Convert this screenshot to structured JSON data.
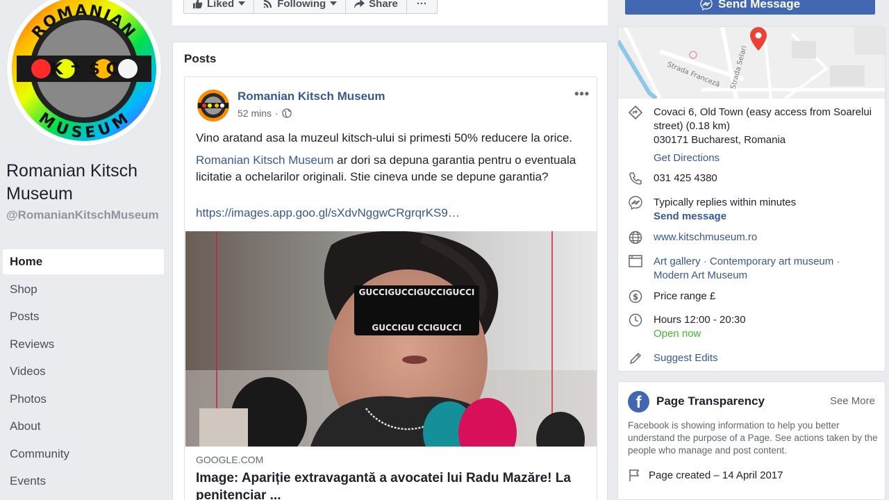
{
  "page": {
    "name": "Romanian Kitsch Museum",
    "handle": "@RomanianKitschMuseum",
    "avatar_text_top": "ROMANIAN",
    "avatar_text_bottom": "MUSEUM",
    "avatar_glyphs": "K ✝ $ C"
  },
  "actions": {
    "liked": "Liked",
    "following": "Following",
    "share": "Share",
    "more": "···",
    "send_message": "Send Message"
  },
  "nav": [
    {
      "label": "Home",
      "active": true
    },
    {
      "label": "Shop"
    },
    {
      "label": "Posts"
    },
    {
      "label": "Reviews"
    },
    {
      "label": "Videos"
    },
    {
      "label": "Photos"
    },
    {
      "label": "About"
    },
    {
      "label": "Community"
    },
    {
      "label": "Events"
    }
  ],
  "posts": {
    "heading": "Posts",
    "post": {
      "author": "Romanian Kitsch Museum",
      "time": "52 mins",
      "time_sep": "·",
      "text1": "Vino aratand asa la muzeul kitsch-ului si primesti 50% reducere la orice.",
      "mention": "Romanian Kitsch Museum",
      "text2": " ar dori sa depuna garantia pentru o eventuala licitatie a ochelarilor originali. Stie cineva unde se depune garantia?",
      "link": "https://images.app.goo.gl/sXdvNggwCRgrqrKS9…",
      "domain": "GOOGLE.COM",
      "headline": "Image: Apariție extravagantă a avocatei lui Radu Mazăre! La penitenciar ...",
      "glasses_text_top": "GUCCIGUCCIGUCCIGUCCI",
      "glasses_text_bottom": "GUCCIGU    CCIGUCCI"
    }
  },
  "info": {
    "map_labels": {
      "street1": "Strada Franceză",
      "street2": "Strada Selari"
    },
    "address_line1": "Covaci 6, Old Town (easy access from Soarelui street) (0.18 km)",
    "address_line2": "030171 Bucharest, Romania",
    "directions": "Get Directions",
    "phone": "031 425 4380",
    "replies": "Typically replies within minutes",
    "send_message": "Send message",
    "website": "www.kitschmuseum.ro",
    "category1": "Art gallery",
    "category2": "Contemporary art museum",
    "category3": "Modern Art Museum",
    "cat_sep": " · ",
    "price": "Price range £",
    "hours": "Hours 12:00 - 20:30",
    "open_now": "Open now",
    "suggest": "Suggest Edits"
  },
  "transparency": {
    "title": "Page Transparency",
    "see_more": "See More",
    "description": "Facebook is showing information to help you better understand the purpose of a Page. See actions taken by the people who manage and post content.",
    "created": "Page created – 14 April 2017"
  },
  "colors": {
    "fb_blue": "#4267b2",
    "link": "#365899",
    "green": "#42b72a",
    "background": "#e9ebee"
  }
}
